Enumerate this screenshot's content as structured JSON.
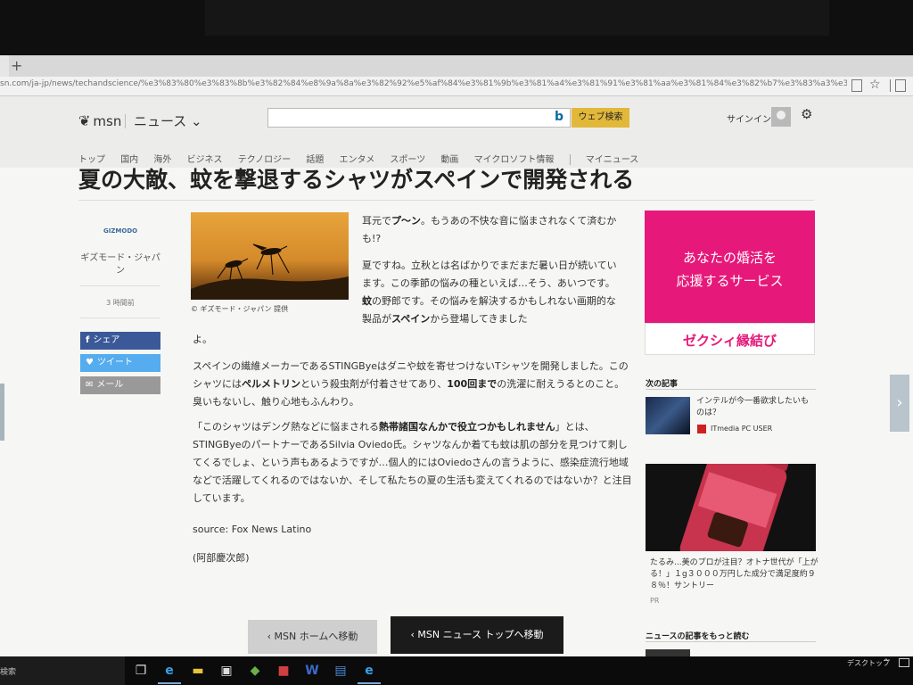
{
  "browser": {
    "new_tab": "+",
    "url": "sn.com/ja-jp/news/techandscience/%e3%83%80%e3%83%8b%e3%82%84%e8%9a%8a%e3%82%92%e5%af%84%e3%81%9b%e3%81%a4%e3%81%91%e3%81%aa%e3%81%84%e3%82%b7%e3%83%a3%e3%83%84%e9%96%8b%e7%99%ba/ar-BBITK1N"
  },
  "header": {
    "logo": "msn",
    "section": "ニュース",
    "search_button": "ウェブ検索",
    "signin": "サインイン"
  },
  "nav": {
    "items": [
      "トップ",
      "国内",
      "海外",
      "ビジネス",
      "テクノロジー",
      "話題",
      "エンタメ",
      "スポーツ",
      "動画",
      "マイクロソフト情報"
    ],
    "my_news": "マイニュース"
  },
  "article": {
    "title": "夏の大敵、蚊を撃退するシャツがスペインで開発される",
    "source_logo": "GIZMODO",
    "source_name": "ギズモード・ジャパン",
    "time_ago": "3 時間前",
    "share": {
      "facebook": "シェア",
      "twitter": "ツイート",
      "mail": "メール"
    },
    "image_caption": "© ギズモード・ジャパン 提供",
    "p1_a": "耳元で",
    "p1_b": "プ〜ン",
    "p1_c": "。もうあの不快な音に悩まされなくて済むかも!?",
    "p2_a": "夏ですね。立秋とは名ばかりでまだまだ暑い日が続いています。この季節の悩みの種といえば…そう、あいつです。",
    "p2_b": "蚊",
    "p2_c": "の野郎です。その悩みを解決するかもしれない画期的な製品が",
    "p2_d": "スペイン",
    "p2_e": "から登場してきました",
    "p2_tail": "よ。",
    "p3_a": "スペインの繊維メーカーであるSTINGByeはダニや蚊を寄せつけないTシャツを開発しました。このシャツには",
    "p3_b": "ペルメトリン",
    "p3_c": "という殺虫剤が付着させてあり、",
    "p3_d": "100回まで",
    "p3_e": "の洗濯に耐えうるとのこと。臭いもないし、触り心地もふんわり。",
    "p4_a": "「このシャツはデング熱などに悩まされる",
    "p4_b": "熱帯諸国なんかで役立つかもしれません",
    "p4_c": "」とは、STINGByeのパートナーであるSilvia Oviedo氏。シャツなんか着ても蚊は肌の部分を見つけて刺してくるでしょ、という声もあるようですが…個人的にはOviedoさんの言うように、感染症流行地域などで活躍してくれるのではないか、そして私たちの夏の生活も変えてくれるのではないか？と注目しています。",
    "source": "source: Fox News Latino",
    "author": "(阿部慶次郎)"
  },
  "ad": {
    "line1": "あなたの婚活を",
    "line2": "応援するサービス",
    "brand": "ゼクシィ縁結び"
  },
  "sidebar": {
    "next_heading": "次の記事",
    "next_title": "インテルが今一番欲求したいものは？",
    "next_source": "ITmedia PC USER",
    "promo_text": "たるみ...美のプロが注目？オトナ世代が「上がる！」１g３０００万円した成分で満足度約９８％！サントリー",
    "promo_label": "PR",
    "more_heading": "ニュースの記事をもっと読む"
  },
  "buttons": {
    "home": "MSN ホームへ移動",
    "news_top": "MSN ニュース トップへ移動"
  },
  "taskbar": {
    "search": "検索",
    "desktop": "デスクトップ"
  }
}
